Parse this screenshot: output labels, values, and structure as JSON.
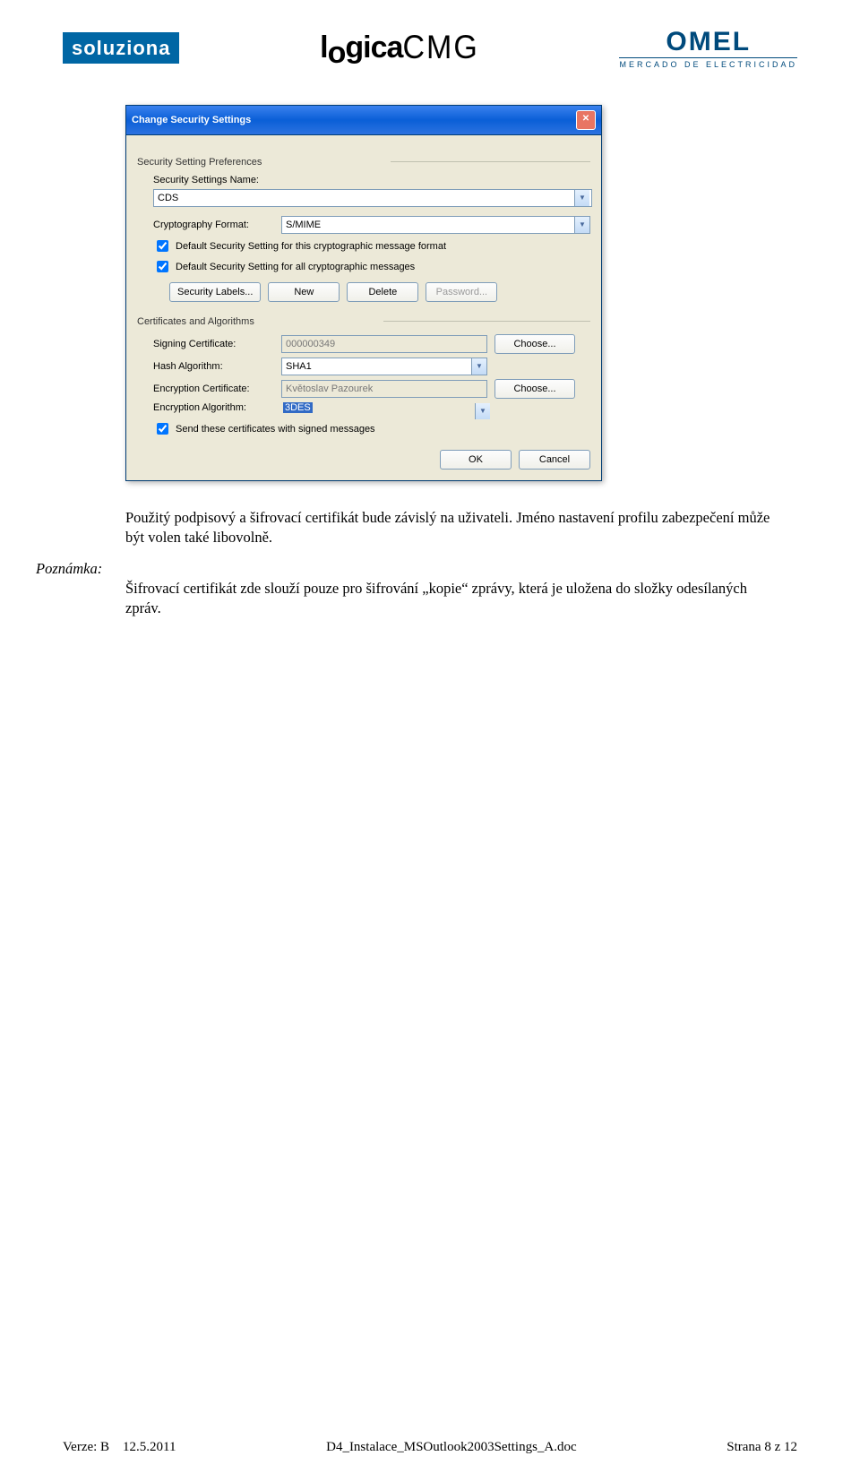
{
  "logos": {
    "soluziona": "soluziona",
    "logica": "logicaCMG",
    "omel_big": "OMEL",
    "omel_small": "MERCADO DE ELECTRICIDAD"
  },
  "dialog": {
    "title": "Change Security Settings",
    "group1_label": "Security Setting Preferences",
    "name_label": "Security Settings Name:",
    "name_value": "CDS",
    "crypt_label": "Cryptography Format:",
    "crypt_value": "S/MIME",
    "chk1": "Default Security Setting for this cryptographic message format",
    "chk2": "Default Security Setting for all cryptographic messages",
    "btn_labels": {
      "security_labels": "Security Labels...",
      "new": "New",
      "delete": "Delete",
      "password": "Password..."
    },
    "group2_label": "Certificates and Algorithms",
    "signing_label": "Signing Certificate:",
    "signing_value": "000000349",
    "choose": "Choose...",
    "hash_label": "Hash Algorithm:",
    "hash_value": "SHA1",
    "enc_cert_label": "Encryption Certificate:",
    "enc_cert_value": "Květoslav Pazourek",
    "enc_algo_label": "Encryption Algorithm:",
    "enc_algo_value": "3DES",
    "chk_send": "Send these certificates with signed messages",
    "ok": "OK",
    "cancel": "Cancel"
  },
  "doc": {
    "p1": "Použitý podpisový a šifrovací certifikát bude závislý na uživateli. Jméno nastavení profilu zabezpečení může být volen také libovolně.",
    "note_label": "Poznámka:",
    "p2": "Šifrovací certifikát zde slouží pouze pro šifrování „kopie“ zprávy, která je uložena do složky odesílaných zpráv."
  },
  "footer": {
    "left": "Verze: B    12.5.2011",
    "center": "D4_Instalace_MSOutlook2003Settings_A.doc",
    "right": "Strana 8 z 12"
  }
}
